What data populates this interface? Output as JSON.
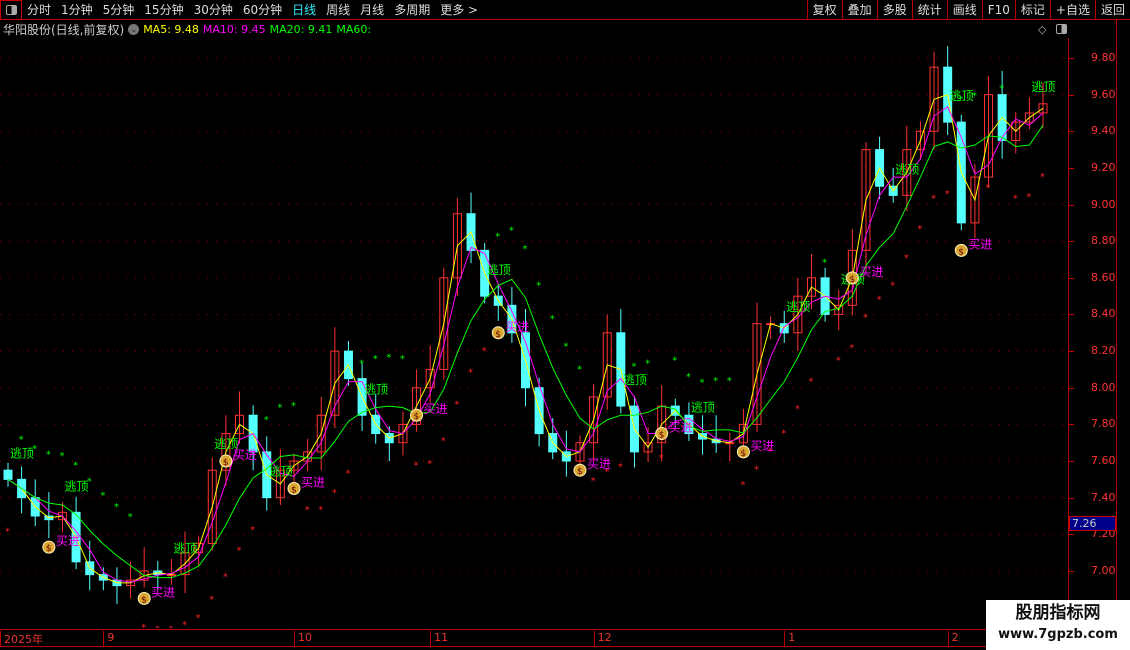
{
  "toolbar": {
    "periods": [
      "分时",
      "1分钟",
      "5分钟",
      "15分钟",
      "30分钟",
      "60分钟",
      "日线",
      "周线",
      "月线",
      "多周期",
      "更多 >"
    ],
    "active": "日线",
    "right_buttons": [
      "复权",
      "叠加",
      "多股",
      "统计",
      "画线",
      "F10",
      "标记",
      "+自选",
      "返回"
    ]
  },
  "info": {
    "title": "华阳股份(日线,前复权)",
    "ma5": "MA5: 9.48",
    "ma10": "MA10: 9.45",
    "ma20": "MA20: 9.41",
    "ma60": "MA60:"
  },
  "colors": {
    "up": "#ff3232",
    "down": "#54ffff",
    "ma5": "#ffff00",
    "ma10": "#ff00ff",
    "ma20": "#00ff00",
    "grid": "#b00000",
    "signal_top": "#00ff00",
    "signal_buy": "#ff00ff"
  },
  "icons": {
    "panel": "panel-toggle-icon",
    "diamond": "diamond-icon",
    "moneybag": "money-bag-icon"
  },
  "current_price": "7.26",
  "chart_data": {
    "type": "candlestick",
    "ylim": [
      6.85,
      9.95
    ],
    "yticks": [
      "9.80",
      "9.60",
      "9.40",
      "9.20",
      "9.00",
      "8.80",
      "8.60",
      "8.40",
      "8.20",
      "8.00",
      "7.80",
      "7.60",
      "7.40",
      "7.20",
      "7.00"
    ],
    "xticks": [
      {
        "label": "2025年",
        "i": 0
      },
      {
        "label": "9",
        "i": 7
      },
      {
        "label": "10",
        "i": 21
      },
      {
        "label": "11",
        "i": 31
      },
      {
        "label": "12",
        "i": 43
      },
      {
        "label": "1",
        "i": 57
      },
      {
        "label": "2",
        "i": 69
      }
    ],
    "close": [
      7.5,
      7.4,
      7.3,
      7.28,
      7.32,
      7.05,
      6.98,
      6.95,
      6.92,
      6.95,
      7.0,
      6.98,
      6.98,
      7.1,
      7.15,
      7.55,
      7.75,
      7.85,
      7.65,
      7.4,
      7.55,
      7.6,
      7.65,
      7.85,
      8.2,
      8.05,
      7.85,
      7.75,
      7.7,
      7.8,
      8.0,
      8.1,
      8.6,
      8.95,
      8.75,
      8.5,
      8.45,
      8.3,
      8.0,
      7.75,
      7.65,
      7.6,
      7.7,
      7.95,
      8.3,
      7.9,
      7.65,
      7.7,
      7.9,
      7.85,
      7.75,
      7.72,
      7.7,
      7.7,
      7.8,
      8.35,
      8.35,
      8.3,
      8.5,
      8.6,
      8.4,
      8.45,
      8.75,
      9.3,
      9.1,
      9.05,
      9.3,
      9.4,
      9.75,
      9.45,
      8.9,
      9.15,
      9.6,
      9.35,
      9.45,
      9.5,
      9.55
    ],
    "signals_top": {
      "label": "逃顶",
      "i": [
        0,
        4,
        12,
        15,
        19,
        26,
        35,
        45,
        50,
        57,
        61,
        65,
        69,
        75
      ]
    },
    "signals_buy": {
      "label": "买进",
      "i": [
        3,
        10,
        16,
        21,
        30,
        36,
        42,
        48,
        54,
        62,
        70
      ]
    }
  },
  "watermark": {
    "line1": "股朋指标网",
    "line2": "www.7gpzb.com"
  }
}
